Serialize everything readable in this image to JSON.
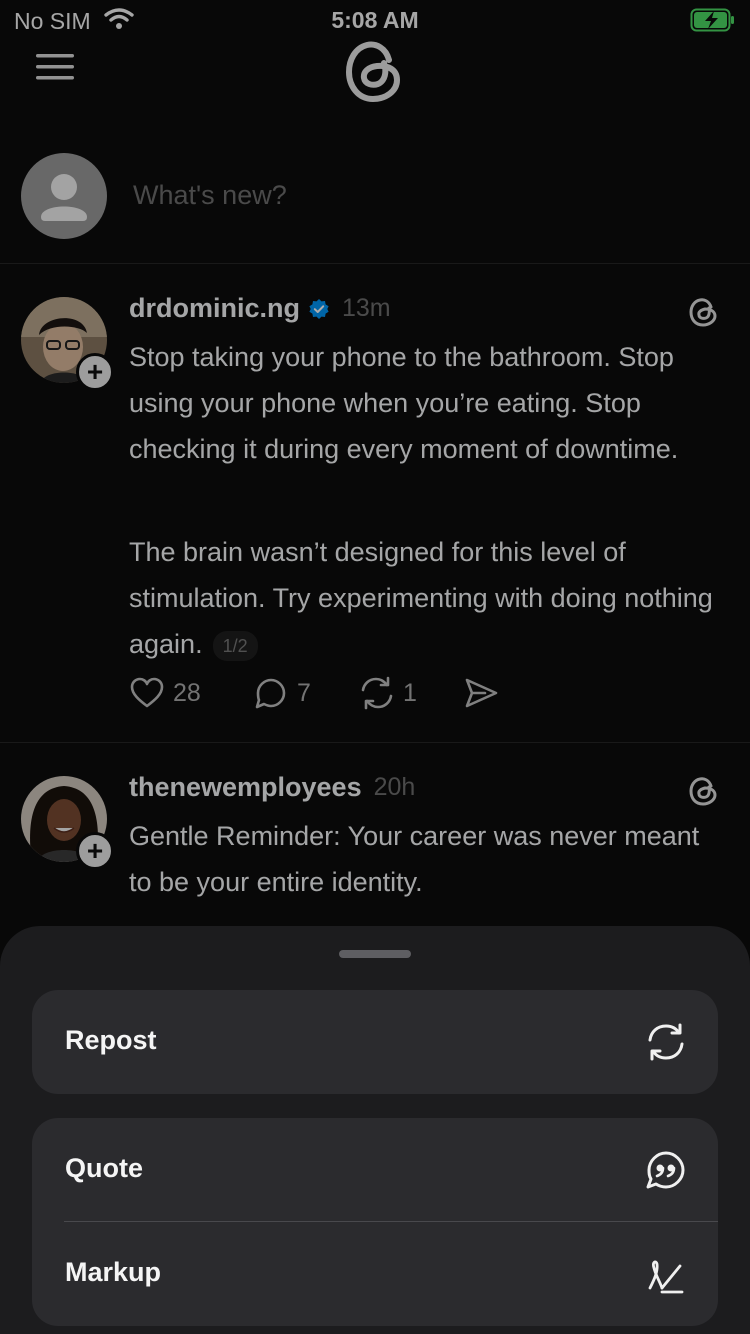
{
  "status_bar": {
    "carrier": "No SIM",
    "time": "5:08 AM"
  },
  "composer": {
    "placeholder": "What's new?"
  },
  "posts": [
    {
      "username": "drdominic.ng",
      "verified": true,
      "time": "13m",
      "paragraphs": [
        "Stop taking your phone to the bathroom. Stop using your phone when you’re eating. Stop checking it during every moment of downtime.",
        "The brain wasn’t designed for this level of stimulation. Try experimenting with doing nothing again."
      ],
      "page_indicator": "1/2",
      "likes": "28",
      "replies": "7",
      "reposts": "1"
    },
    {
      "username": "thenewemployees",
      "verified": false,
      "time": "20h",
      "paragraphs": [
        "Gentle Reminder: Your career was never meant to be your entire identity."
      ]
    }
  ],
  "sheet": {
    "options": [
      {
        "label": "Repost",
        "icon": "repost-icon"
      },
      {
        "label": "Quote",
        "icon": "quote-icon"
      },
      {
        "label": "Markup",
        "icon": "markup-icon"
      }
    ]
  },
  "colors": {
    "background": "#0c0c0c",
    "sheet": "#1c1c1e",
    "option": "#2b2b2e",
    "verified": "#0095f6",
    "battery": "#4cd964"
  }
}
